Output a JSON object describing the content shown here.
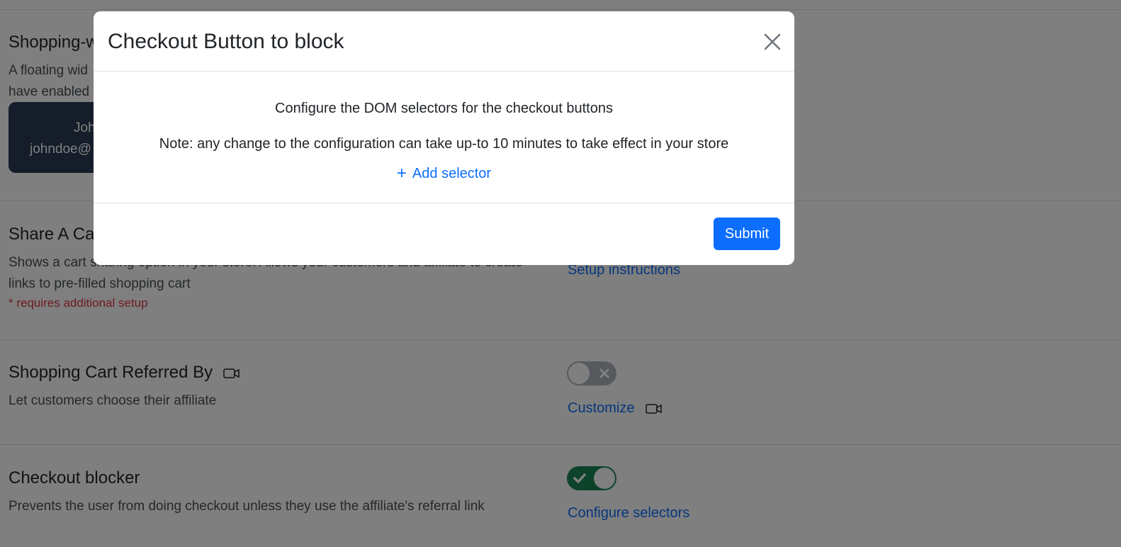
{
  "colors": {
    "accent": "#0d6efd",
    "danger": "#dc3545",
    "success": "#198754",
    "backdrop": "rgba(0,0,0,0.5)"
  },
  "sections": {
    "shopping_widget": {
      "title": "Shopping-w",
      "desc_line1": "A floating wid",
      "desc_line2": "have enabled",
      "user_name": "Joh",
      "user_email": "johndoe@"
    },
    "share_cart": {
      "title": "Share A Ca",
      "desc_line1": "Shows a cart sharing option in your store. Allows your customers and affiliate to create",
      "desc_line2": "links to pre-filled shopping cart",
      "requires_note": "* requires additional setup",
      "link": "Setup instructions"
    },
    "referred_by": {
      "title": "Shopping Cart Referred By",
      "desc": "Let customers choose their affiliate",
      "toggle": "off",
      "link": "Customize",
      "icon": "video-camera-icon"
    },
    "checkout_blocker": {
      "title": "Checkout blocker",
      "desc": "Prevents the user from doing checkout unless they use the affiliate's referral link",
      "toggle": "on",
      "link": "Configure selectors"
    }
  },
  "modal": {
    "title": "Checkout Button to block",
    "close_icon": "close-icon",
    "line1": "Configure the DOM selectors for the checkout buttons",
    "line2": "Note: any change to the configuration can take up-to 10 minutes to take effect in your store",
    "add_selector": "Add selector",
    "add_icon": "plus-icon",
    "submit": "Submit"
  }
}
